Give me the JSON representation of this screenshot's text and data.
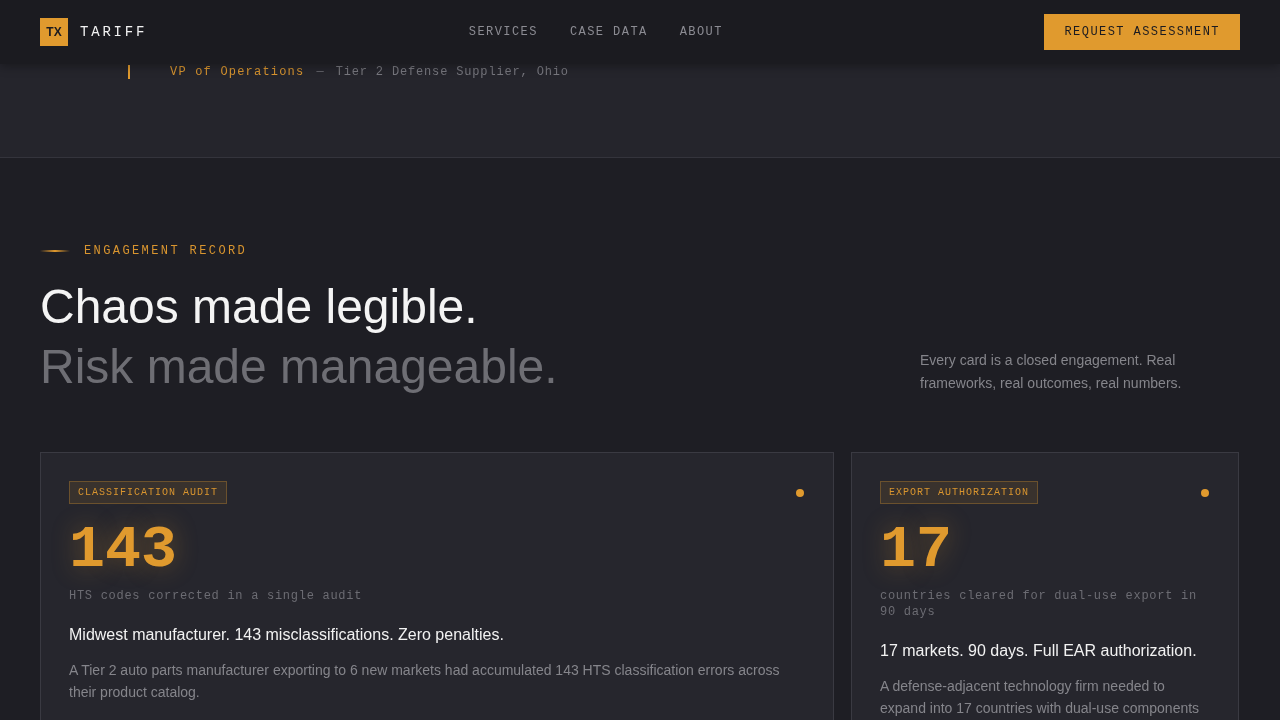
{
  "header": {
    "logo_mark": "TX",
    "brand": "TARIFF",
    "nav": [
      "SERVICES",
      "CASE DATA",
      "ABOUT"
    ],
    "cta": "REQUEST ASSESSMENT"
  },
  "testimonial": {
    "role": "VP of Operations",
    "separator": "—",
    "company": "Tier 2 Defense Supplier, Ohio"
  },
  "section": {
    "eyebrow": "ENGAGEMENT RECORD",
    "headline": "Chaos made legible.",
    "headline_muted": "Risk made manageable.",
    "intro": "Every card is a closed engagement. Real frameworks, real outcomes, real numbers."
  },
  "cards": [
    {
      "tag": "CLASSIFICATION AUDIT",
      "stat": "143",
      "stat_label": "HTS codes corrected in a single audit",
      "title": "Midwest manufacturer. 143 misclassifications. Zero penalties.",
      "body": "A Tier 2 auto parts manufacturer exporting to 6 new markets had accumulated 143 HTS classification errors across their product catalog."
    },
    {
      "tag": "EXPORT AUTHORIZATION",
      "stat": "17",
      "stat_label": "countries cleared for dual-use export in 90 days",
      "title": "17 markets. 90 days. Full EAR authorization.",
      "body": "A defense-adjacent technology firm needed to expand into 17 countries with dual-use components"
    }
  ]
}
